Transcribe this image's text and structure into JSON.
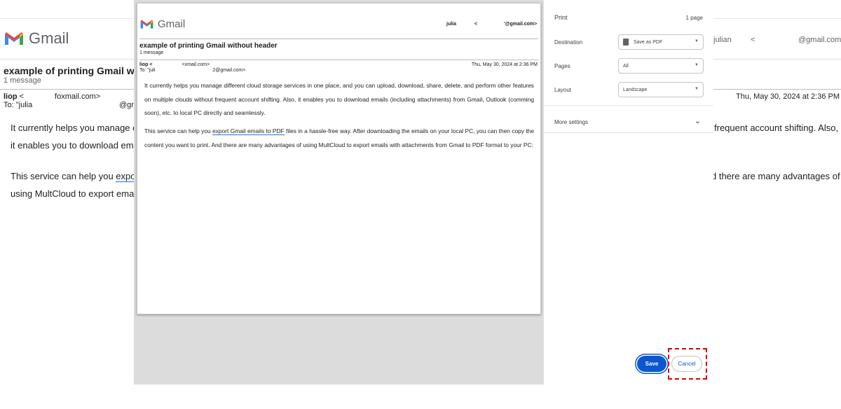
{
  "background": {
    "brand": "Gmail",
    "header_user": "julian",
    "header_lt": "<",
    "header_email": "@gmail.com>",
    "subject": "example of printing Gmail w",
    "message_count": "1 message",
    "from_name": "liop",
    "from_rest": " <",
    "from_domain": "foxmail.com>",
    "to": "To: \"julia",
    "to_domain": "@gn",
    "date": "Thu, May 30, 2024 at 2:36 PM",
    "para1_line1": "It currently helps you manage c",
    "para1_line1_right": "frequent account shifting. Also,",
    "para1_line2": "it enables you to download ema",
    "para2_line1_a": "This service can help you ",
    "para2_line1_link": "expor",
    "para2_line1_right": "d there are many advantages of",
    "para2_line2": "using MultCloud to export email"
  },
  "preview": {
    "brand": "Gmail",
    "user_name": "julia",
    "user_lt": "<",
    "user_email": "'@gmail.com>",
    "subject": "example of printing Gmail without header",
    "message_count": "1 message",
    "from": "liop <",
    "from_domain": "<xmail.com>",
    "to": "To: \"juli",
    "to_email": "2@gmail.com>",
    "date": "Thu, May 30, 2024 at 2:36 PM",
    "para1": "It currently helps you manage different cloud storage services in one place, and you can upload, download, share, delete, and perform other features on multiple clouds without frequent account shifting. Also, it enables you to download emails (including attachments) from Gmail, Outlook (comming soon), etc. to local PC directly and seamlessly.",
    "para2_a": "This service can help you ",
    "para2_link": "export Gmail emails to PDF",
    "para2_b": " files in a hassle-free way. After downloading the emails on your local PC, you can then copy the content you want to print. And there are many advantages of using MultCloud to export emails with attachments from Gmail to PDF format to your PC:"
  },
  "print_panel": {
    "title": "Print",
    "pages_count": "1 page",
    "destination_label": "Destination",
    "destination_value": "Save as PDF",
    "pages_label": "Pages",
    "pages_value": "All",
    "layout_label": "Layout",
    "layout_value": "Landscape",
    "more_settings": "More settings",
    "save_label": "Save",
    "cancel_label": "Cancel"
  },
  "colors": {
    "accent": "#0b57d0",
    "highlight": "#d50000",
    "link_underline": "#1a73e8"
  }
}
